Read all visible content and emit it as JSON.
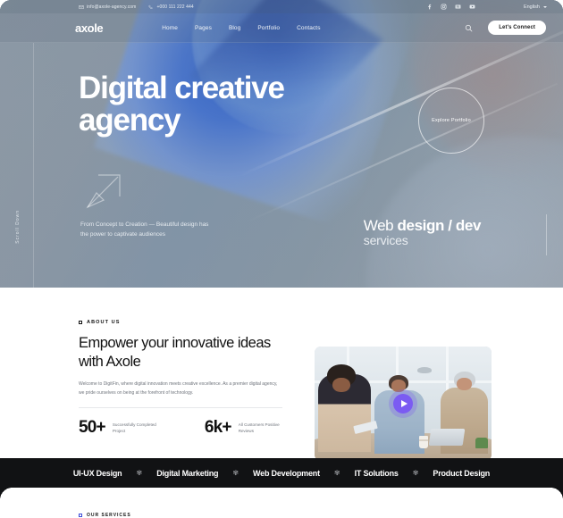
{
  "topbar": {
    "email": "info@axole-agency.com",
    "email_icon": "mail-icon",
    "phone": "+000 111 222 444",
    "phone_icon": "phone-icon",
    "socials": [
      "facebook-icon",
      "instagram-icon",
      "behance-icon",
      "youtube-icon"
    ],
    "language": "English"
  },
  "nav": {
    "logo": "axole",
    "items": [
      {
        "label": "Home"
      },
      {
        "label": "Pages"
      },
      {
        "label": "Blog"
      },
      {
        "label": "Portfolio"
      },
      {
        "label": "Contacts"
      }
    ],
    "search_icon": "search-icon",
    "cta": "Let's Connect"
  },
  "hero": {
    "title": "Digital creative agency",
    "explore": "Explore Portfolio",
    "arrow_icon": "arrow-up-right-icon",
    "subtext": "From Concept to Creation — Beautiful design has the power to captivate audiences",
    "right_line1_a": "Web ",
    "right_line1_b": "design / dev",
    "right_line2": "services",
    "scroll": "Scroll Down"
  },
  "about": {
    "tag": "ABOUT US",
    "heading": "Empower your innovative ideas with Axole",
    "paragraph": "Welcome to DigitFin, where digital innovation meets creative excellence. As a premier digital agency, we pride ourselves on being at the forefront of technology.",
    "stats": [
      {
        "value": "50+",
        "label": "Successfully Completed Project"
      },
      {
        "value": "6k+",
        "label": "All Customers Positive Reviews"
      }
    ],
    "media": {
      "alt": "team-meeting-photo",
      "play_icon": "play-button-icon",
      "play_color": "#7b5bf2"
    }
  },
  "marquee": {
    "items": [
      "UI-UX Design",
      "Digital Marketing",
      "Web Development",
      "IT Solutions",
      "Product Design"
    ],
    "separator_icon": "flower-asterisk-icon",
    "separator": "✾",
    "background": "#111214"
  },
  "bottom": {
    "tag": "OUR SERVICES",
    "accent": "#3b4bd8"
  }
}
